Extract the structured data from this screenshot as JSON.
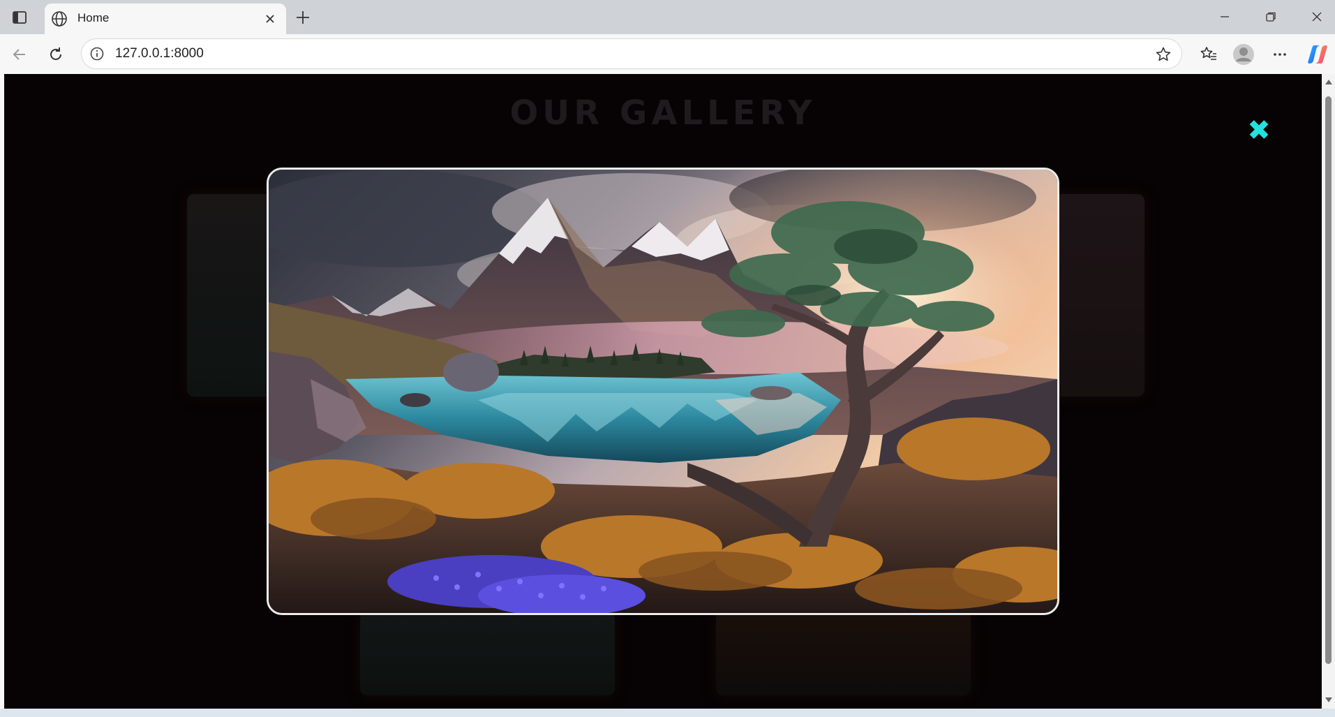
{
  "browser": {
    "tab_title": "Home",
    "url": "127.0.0.1:8000",
    "icons": {
      "sidebar": "tab-sidebar-icon",
      "favicon": "globe-icon",
      "tab_close": "close-icon",
      "new_tab": "plus-icon",
      "minimize": "minimize-icon",
      "restore": "restore-icon",
      "close_window": "close-icon",
      "back": "back-arrow-icon",
      "reload": "reload-icon",
      "site_info": "info-icon",
      "favorite": "star-icon",
      "favorites_list": "favorites-icon",
      "profile": "profile-icon",
      "menu": "more-icon",
      "copilot": "copilot-icon"
    }
  },
  "page": {
    "heading": "OUR GALLERY",
    "close_symbol": "✖",
    "accent_color": "#24e0e0",
    "background_color": "#070203",
    "lightbox": {
      "image_subject": "mountain-lake-landscape-image"
    }
  }
}
